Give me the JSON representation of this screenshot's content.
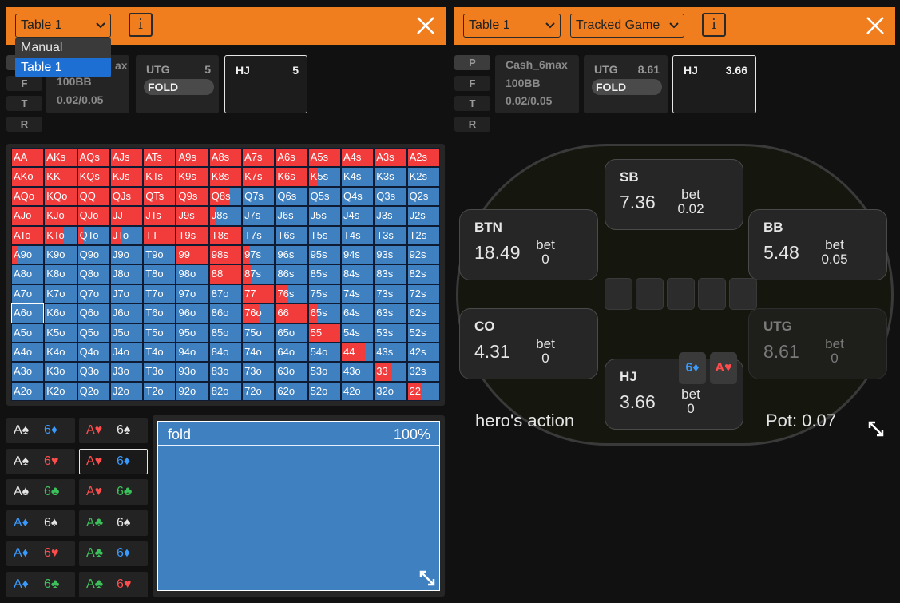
{
  "colors": {
    "accent_orange": "#f07d1e",
    "raise_red": "#f23b3b",
    "fold_blue": "#3f80c1",
    "dropdown_selected": "#1e6fd4"
  },
  "left": {
    "table_select": "Table 1",
    "dropdown_options": [
      "Manual",
      "Table 1"
    ],
    "dropdown_selected": "Table 1",
    "info_label": "i",
    "prt": [
      "P",
      "F",
      "T",
      "R"
    ],
    "game_info": {
      "type_partial": "ax",
      "depth": "100BB",
      "stakes": "0.02/0.05"
    },
    "positions": [
      {
        "name": "UTG",
        "stack": "5",
        "action": "FOLD"
      },
      {
        "name": "HJ",
        "stack": "5"
      }
    ],
    "grid": [
      [
        [
          "AA",
          1
        ],
        [
          "AKs",
          1
        ],
        [
          "AQs",
          1
        ],
        [
          "AJs",
          1
        ],
        [
          "ATs",
          1
        ],
        [
          "A9s",
          1
        ],
        [
          "A8s",
          1
        ],
        [
          "A7s",
          1
        ],
        [
          "A6s",
          1
        ],
        [
          "A5s",
          1
        ],
        [
          "A4s",
          1
        ],
        [
          "A3s",
          1
        ],
        [
          "A2s",
          1
        ]
      ],
      [
        [
          "AKo",
          1
        ],
        [
          "KK",
          1
        ],
        [
          "KQs",
          1
        ],
        [
          "KJs",
          1
        ],
        [
          "KTs",
          1
        ],
        [
          "K9s",
          1
        ],
        [
          "K8s",
          1
        ],
        [
          "K7s",
          1
        ],
        [
          "K6s",
          1
        ],
        [
          "K5s",
          0.3
        ],
        [
          "K4s",
          0
        ],
        [
          "K3s",
          0
        ],
        [
          "K2s",
          0
        ]
      ],
      [
        [
          "AQo",
          1
        ],
        [
          "KQo",
          1
        ],
        [
          "QQ",
          1
        ],
        [
          "QJs",
          1
        ],
        [
          "QTs",
          1
        ],
        [
          "Q9s",
          1
        ],
        [
          "Q8s",
          0.65
        ],
        [
          "Q7s",
          0
        ],
        [
          "Q6s",
          0
        ],
        [
          "Q5s",
          0
        ],
        [
          "Q4s",
          0
        ],
        [
          "Q3s",
          0
        ],
        [
          "Q2s",
          0
        ]
      ],
      [
        [
          "AJo",
          1
        ],
        [
          "KJo",
          1
        ],
        [
          "QJo",
          1
        ],
        [
          "JJ",
          1
        ],
        [
          "JTs",
          1
        ],
        [
          "J9s",
          1
        ],
        [
          "J8s",
          0.2
        ],
        [
          "J7s",
          0
        ],
        [
          "J6s",
          0
        ],
        [
          "J5s",
          0
        ],
        [
          "J4s",
          0
        ],
        [
          "J3s",
          0
        ],
        [
          "J2s",
          0
        ]
      ],
      [
        [
          "ATo",
          1
        ],
        [
          "KTo",
          0.6
        ],
        [
          "QTo",
          0.2
        ],
        [
          "JTo",
          0.3
        ],
        [
          "TT",
          1
        ],
        [
          "T9s",
          1
        ],
        [
          "T8s",
          1
        ],
        [
          "T7s",
          0
        ],
        [
          "T6s",
          0
        ],
        [
          "T5s",
          0
        ],
        [
          "T4s",
          0
        ],
        [
          "T3s",
          0
        ],
        [
          "T2s",
          0
        ]
      ],
      [
        [
          "A9o",
          0.15
        ],
        [
          "K9o",
          0
        ],
        [
          "Q9o",
          0
        ],
        [
          "J9o",
          0
        ],
        [
          "T9o",
          0
        ],
        [
          "99",
          1
        ],
        [
          "98s",
          1
        ],
        [
          "97s",
          0.2
        ],
        [
          "96s",
          0
        ],
        [
          "95s",
          0
        ],
        [
          "94s",
          0
        ],
        [
          "93s",
          0
        ],
        [
          "92s",
          0
        ]
      ],
      [
        [
          "A8o",
          0
        ],
        [
          "K8o",
          0
        ],
        [
          "Q8o",
          0
        ],
        [
          "J8o",
          0
        ],
        [
          "T8o",
          0
        ],
        [
          "98o",
          0
        ],
        [
          "88",
          1
        ],
        [
          "87s",
          0.3
        ],
        [
          "86s",
          0
        ],
        [
          "85s",
          0
        ],
        [
          "84s",
          0
        ],
        [
          "83s",
          0
        ],
        [
          "82s",
          0
        ]
      ],
      [
        [
          "A7o",
          0
        ],
        [
          "K7o",
          0
        ],
        [
          "Q7o",
          0
        ],
        [
          "J7o",
          0
        ],
        [
          "T7o",
          0
        ],
        [
          "97o",
          0
        ],
        [
          "87o",
          0
        ],
        [
          "77",
          1
        ],
        [
          "76s",
          0.4
        ],
        [
          "75s",
          0
        ],
        [
          "74s",
          0
        ],
        [
          "73s",
          0
        ],
        [
          "72s",
          0
        ]
      ],
      [
        [
          "A6o",
          0
        ],
        [
          "K6o",
          0
        ],
        [
          "Q6o",
          0
        ],
        [
          "J6o",
          0
        ],
        [
          "T6o",
          0
        ],
        [
          "96o",
          0
        ],
        [
          "86o",
          0
        ],
        [
          "76o",
          0.5
        ],
        [
          "66",
          1
        ],
        [
          "65s",
          0.3
        ],
        [
          "64s",
          0
        ],
        [
          "63s",
          0
        ],
        [
          "62s",
          0
        ]
      ],
      [
        [
          "A5o",
          0
        ],
        [
          "K5o",
          0
        ],
        [
          "Q5o",
          0
        ],
        [
          "J5o",
          0
        ],
        [
          "T5o",
          0
        ],
        [
          "95o",
          0
        ],
        [
          "85o",
          0
        ],
        [
          "75o",
          0
        ],
        [
          "65o",
          0
        ],
        [
          "55",
          1
        ],
        [
          "54s",
          0
        ],
        [
          "53s",
          0
        ],
        [
          "52s",
          0
        ]
      ],
      [
        [
          "A4o",
          0
        ],
        [
          "K4o",
          0
        ],
        [
          "Q4o",
          0
        ],
        [
          "J4o",
          0
        ],
        [
          "T4o",
          0
        ],
        [
          "94o",
          0
        ],
        [
          "84o",
          0
        ],
        [
          "74o",
          0
        ],
        [
          "64o",
          0
        ],
        [
          "54o",
          0
        ],
        [
          "44",
          0.75
        ],
        [
          "43s",
          0
        ],
        [
          "42s",
          0
        ]
      ],
      [
        [
          "A3o",
          0
        ],
        [
          "K3o",
          0
        ],
        [
          "Q3o",
          0
        ],
        [
          "J3o",
          0
        ],
        [
          "T3o",
          0
        ],
        [
          "93o",
          0
        ],
        [
          "83o",
          0
        ],
        [
          "73o",
          0
        ],
        [
          "63o",
          0
        ],
        [
          "53o",
          0
        ],
        [
          "43o",
          0
        ],
        [
          "33",
          0.55
        ],
        [
          "32s",
          0
        ]
      ],
      [
        [
          "A2o",
          0
        ],
        [
          "K2o",
          0
        ],
        [
          "Q2o",
          0
        ],
        [
          "J2o",
          0
        ],
        [
          "T2o",
          0
        ],
        [
          "92o",
          0
        ],
        [
          "82o",
          0
        ],
        [
          "72o",
          0
        ],
        [
          "62o",
          0
        ],
        [
          "52o",
          0
        ],
        [
          "42o",
          0
        ],
        [
          "32o",
          0
        ],
        [
          "22",
          0.45
        ]
      ]
    ],
    "selected_cell": "A6o",
    "combos": [
      {
        "r1": "A",
        "s1": "♠",
        "c1": "white",
        "r2": "6",
        "s2": "♦",
        "c2": "blue"
      },
      {
        "r1": "A",
        "s1": "♥",
        "c1": "red",
        "r2": "6",
        "s2": "♠",
        "c2": "white"
      },
      {
        "r1": "A",
        "s1": "♠",
        "c1": "white",
        "r2": "6",
        "s2": "♥",
        "c2": "red"
      },
      {
        "r1": "A",
        "s1": "♥",
        "c1": "red",
        "r2": "6",
        "s2": "♦",
        "c2": "blue",
        "selected": true
      },
      {
        "r1": "A",
        "s1": "♠",
        "c1": "white",
        "r2": "6",
        "s2": "♣",
        "c2": "green"
      },
      {
        "r1": "A",
        "s1": "♥",
        "c1": "red",
        "r2": "6",
        "s2": "♣",
        "c2": "green"
      },
      {
        "r1": "A",
        "s1": "♦",
        "c1": "blue",
        "r2": "6",
        "s2": "♠",
        "c2": "white"
      },
      {
        "r1": "A",
        "s1": "♣",
        "c1": "green",
        "r2": "6",
        "s2": "♠",
        "c2": "white"
      },
      {
        "r1": "A",
        "s1": "♦",
        "c1": "blue",
        "r2": "6",
        "s2": "♥",
        "c2": "red"
      },
      {
        "r1": "A",
        "s1": "♣",
        "c1": "green",
        "r2": "6",
        "s2": "♦",
        "c2": "blue"
      },
      {
        "r1": "A",
        "s1": "♦",
        "c1": "blue",
        "r2": "6",
        "s2": "♣",
        "c2": "green"
      },
      {
        "r1": "A",
        "s1": "♣",
        "c1": "green",
        "r2": "6",
        "s2": "♥",
        "c2": "red"
      }
    ],
    "action": {
      "name": "fold",
      "pct": "100%"
    }
  },
  "right": {
    "table_select": "Table 1",
    "game_select": "Tracked Game",
    "info_label": "i",
    "prt": [
      "P",
      "F",
      "T",
      "R"
    ],
    "game_info": {
      "type": "Cash_6max",
      "depth": "100BB",
      "stakes": "0.02/0.05"
    },
    "positions": [
      {
        "name": "UTG",
        "stack": "8.61",
        "action": "FOLD"
      },
      {
        "name": "HJ",
        "stack": "3.66"
      }
    ],
    "seats": {
      "sb": {
        "name": "SB",
        "stack": "7.36",
        "bet_label": "bet",
        "bet": "0.02"
      },
      "btn": {
        "name": "BTN",
        "stack": "18.49",
        "bet_label": "bet",
        "bet": "0"
      },
      "bb": {
        "name": "BB",
        "stack": "5.48",
        "bet_label": "bet",
        "bet": "0.05"
      },
      "co": {
        "name": "CO",
        "stack": "4.31",
        "bet_label": "bet",
        "bet": "0"
      },
      "utg": {
        "name": "UTG",
        "stack": "8.61",
        "bet_label": "bet",
        "bet": "0"
      },
      "hj": {
        "name": "HJ",
        "stack": "3.66",
        "bet_label": "bet",
        "bet": "0"
      }
    },
    "hero_cards": [
      {
        "rank": "6",
        "suit": "♦",
        "color": "blue"
      },
      {
        "rank": "A",
        "suit": "♥",
        "color": "red"
      }
    ],
    "hero_action": "hero's action",
    "pot": "Pot: 0.07"
  }
}
